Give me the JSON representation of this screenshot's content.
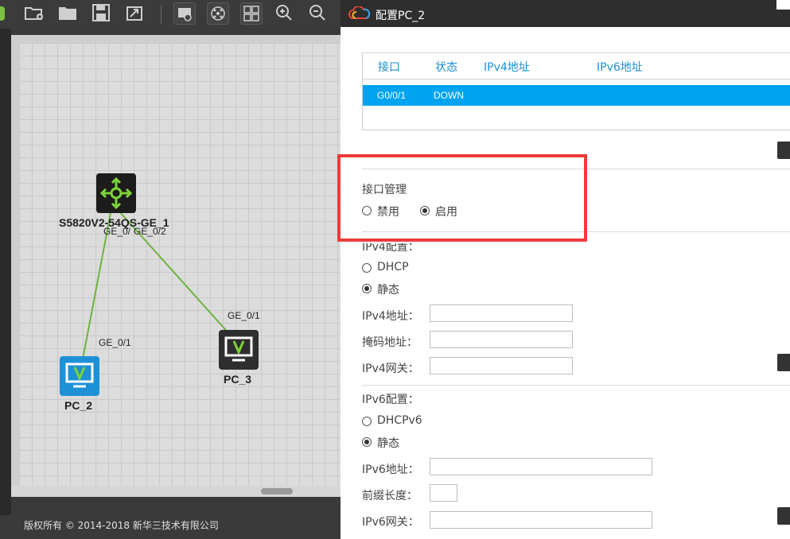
{
  "toolbar": {
    "icons": [
      "add-folder-icon",
      "folder-icon",
      "save-icon",
      "export-icon",
      "screenshot-icon",
      "topology-icon",
      "layout-icon",
      "zoom-in-icon",
      "zoom-out-icon"
    ]
  },
  "topology": {
    "devices": [
      {
        "name": "S5820V2-54QS-GE_1",
        "type": "switch"
      },
      {
        "name": "PC_2",
        "type": "pc",
        "color": "#1e90d6"
      },
      {
        "name": "PC_3",
        "type": "pc",
        "color": "#2e2e2e"
      }
    ],
    "ports": [
      "GE_0/",
      "GE_0/2",
      "GE_0/1",
      "GE_0/1"
    ],
    "link_color": "#6db33f"
  },
  "footer": {
    "copyright": "版权所有 © 2014-2018 新华三技术有限公司"
  },
  "dialog": {
    "title": "配置PC_2",
    "table": {
      "headers": [
        "接口",
        "状态",
        "IPv4地址",
        "IPv6地址"
      ],
      "rows": [
        {
          "iface": "G0/0/1",
          "status": "DOWN",
          "ipv4": "",
          "ipv6": ""
        }
      ]
    },
    "iface_mgmt": {
      "title": "接口管理",
      "options": [
        "禁用",
        "启用"
      ],
      "selected": "启用"
    },
    "ipv4": {
      "title": "IPv4配置：",
      "modes": [
        "DHCP",
        "静态"
      ],
      "selected": "静态",
      "fields": [
        {
          "label": "IPv4地址：",
          "value": ""
        },
        {
          "label": "掩码地址：",
          "value": ""
        },
        {
          "label": "IPv4网关：",
          "value": ""
        }
      ]
    },
    "ipv6": {
      "title": "IPv6配置：",
      "modes": [
        "DHCPv6",
        "静态"
      ],
      "selected": "静态",
      "fields": [
        {
          "label": "IPv6地址：",
          "value": ""
        },
        {
          "label": "前缀长度：",
          "value": ""
        },
        {
          "label": "IPv6网关：",
          "value": ""
        }
      ]
    },
    "highlight_color": "#ee3b3b",
    "accent": "#00a3f0"
  }
}
